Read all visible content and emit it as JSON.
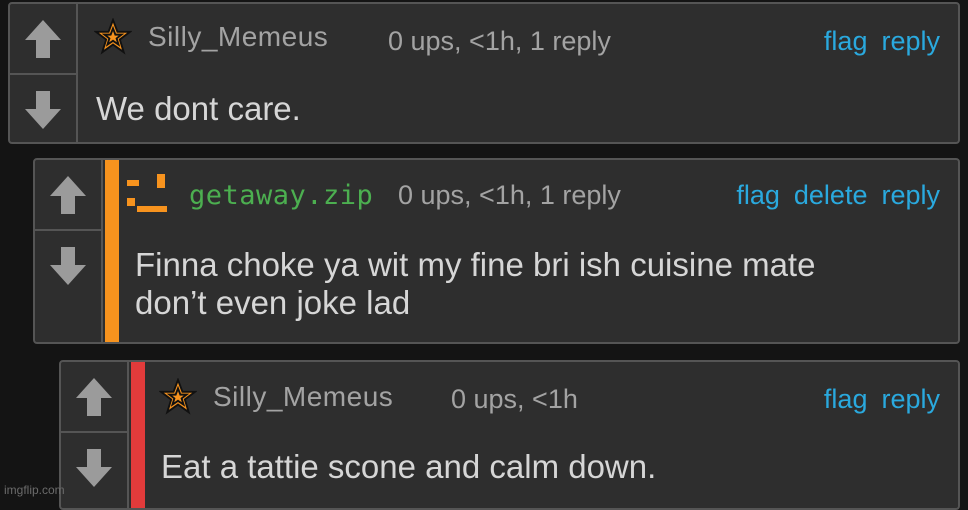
{
  "colors": {
    "background": "#141414",
    "panel": "#2e2e2e",
    "border": "#555555",
    "link": "#2aa9de",
    "orange_accent": "#f7931e",
    "red_accent": "#e23b3b",
    "green_username": "#4caf50"
  },
  "comments": [
    {
      "username": "Silly_Memeus",
      "username_color": "#a3a3a3",
      "badge_icon": "star-icon",
      "meta": "0 ups, <1h, 1 reply",
      "actions": [
        "flag",
        "reply"
      ],
      "text": "We dont care."
    },
    {
      "username": "getaway.zip",
      "username_color": "#4caf50",
      "badge_icon": "pixel-badge-icon",
      "meta": "0 ups, <1h, 1 reply",
      "actions": [
        "flag",
        "delete",
        "reply"
      ],
      "text_lines": [
        "Finna choke ya wit my fine bri ish cuisine mate",
        "don’t even joke lad"
      ]
    },
    {
      "username": "Silly_Memeus",
      "username_color": "#a3a3a3",
      "badge_icon": "star-icon",
      "meta": "0 ups, <1h",
      "actions": [
        "flag",
        "reply"
      ],
      "text": "Eat a tattie scone and calm down."
    }
  ],
  "watermark": "imgflip.com"
}
